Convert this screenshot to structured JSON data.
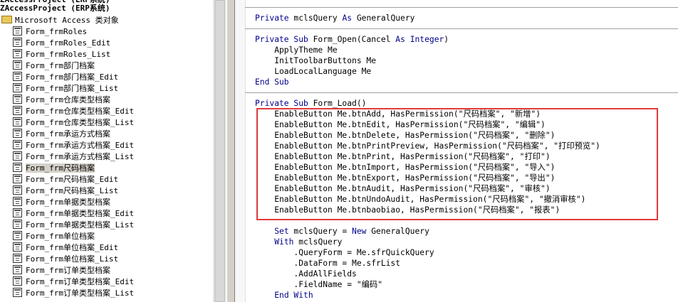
{
  "explorer": {
    "header_partial": "ZAccessProject (ERP系统)",
    "project_label": "ZAccessProject (ERP系统)",
    "folder_label": "Microsoft Access 类对象",
    "items": [
      "Form_frmRoles",
      "Form_frmRoles_Edit",
      "Form_frmRoles_List",
      "Form_frm部门档案",
      "Form_frm部门档案_Edit",
      "Form_frm部门档案_List",
      "Form_frm仓库类型档案",
      "Form_frm仓库类型档案_Edit",
      "Form_frm仓库类型档案_List",
      "Form_frm承运方式档案",
      "Form_frm承运方式档案_Edit",
      "Form_frm承运方式档案_List",
      "Form_frm尺码档案",
      "Form_frm尺码档案_Edit",
      "Form_frm尺码档案_List",
      "Form_frm单据类型档案",
      "Form_frm单据类型档案_Edit",
      "Form_frm单据类型档案_List",
      "Form_frm单位档案",
      "Form_frm单位档案_Edit",
      "Form_frm单位档案_List",
      "Form_frm订单类型档案",
      "Form_frm订单类型档案_Edit",
      "Form_frm订单类型档案_List"
    ],
    "selected_index": 12
  },
  "code": {
    "lines": [
      {
        "kw": "Private",
        "text": " mclsQuery As GeneralQuery"
      },
      {
        "kw": "Private Sub",
        "text": " Form_Open(Cancel As Integer)"
      },
      {
        "kw": "",
        "text": "    ApplyTheme Me"
      },
      {
        "kw": "",
        "text": "    InitToolbarButtons Me"
      },
      {
        "kw": "",
        "text": "    LoadLocalLanguage Me"
      },
      {
        "kw": "End Sub",
        "text": ""
      },
      {
        "kw": "Private Sub",
        "text": " Form_Load()"
      },
      {
        "kw": "",
        "text": "    EnableButton Me.btnAdd, HasPermission(\"尺码档案\", \"新增\")"
      },
      {
        "kw": "",
        "text": "    EnableButton Me.btnEdit, HasPermission(\"尺码档案\", \"编辑\")"
      },
      {
        "kw": "",
        "text": "    EnableButton Me.btnDelete, HasPermission(\"尺码档案\", \"删除\")"
      },
      {
        "kw": "",
        "text": "    EnableButton Me.btnPrintPreview, HasPermission(\"尺码档案\", \"打印预览\")"
      },
      {
        "kw": "",
        "text": "    EnableButton Me.btnPrint, HasPermission(\"尺码档案\", \"打印\")"
      },
      {
        "kw": "",
        "text": "    EnableButton Me.btnImport, HasPermission(\"尺码档案\", \"导入\")"
      },
      {
        "kw": "",
        "text": "    EnableButton Me.btnExport, HasPermission(\"尺码档案\", \"导出\")"
      },
      {
        "kw": "",
        "text": "    EnableButton Me.btnAudit, HasPermission(\"尺码档案\", \"审核\")"
      },
      {
        "kw": "",
        "text": "    EnableButton Me.btnUndoAudit, HasPermission(\"尺码档案\", \"撤消审核\")"
      },
      {
        "kw": "",
        "text": "    EnableButton Me.btnbaobiao, HasPermission(\"尺码档案\", \"报表\")"
      },
      {
        "kw": "",
        "text": ""
      },
      {
        "kw": "",
        "text": "    Set mclsQuery = New GeneralQuery"
      },
      {
        "kw": "",
        "text": "    With mclsQuery"
      },
      {
        "kw": "",
        "text": "        .QueryForm = Me.sfrQuickQuery"
      },
      {
        "kw": "",
        "text": "        .DataForm = Me.sfrList"
      },
      {
        "kw": "",
        "text": "        .AddAllFields"
      },
      {
        "kw": "",
        "text": "        .FieldName = \"编码\""
      },
      {
        "kw": "",
        "text": "    End With"
      }
    ]
  }
}
